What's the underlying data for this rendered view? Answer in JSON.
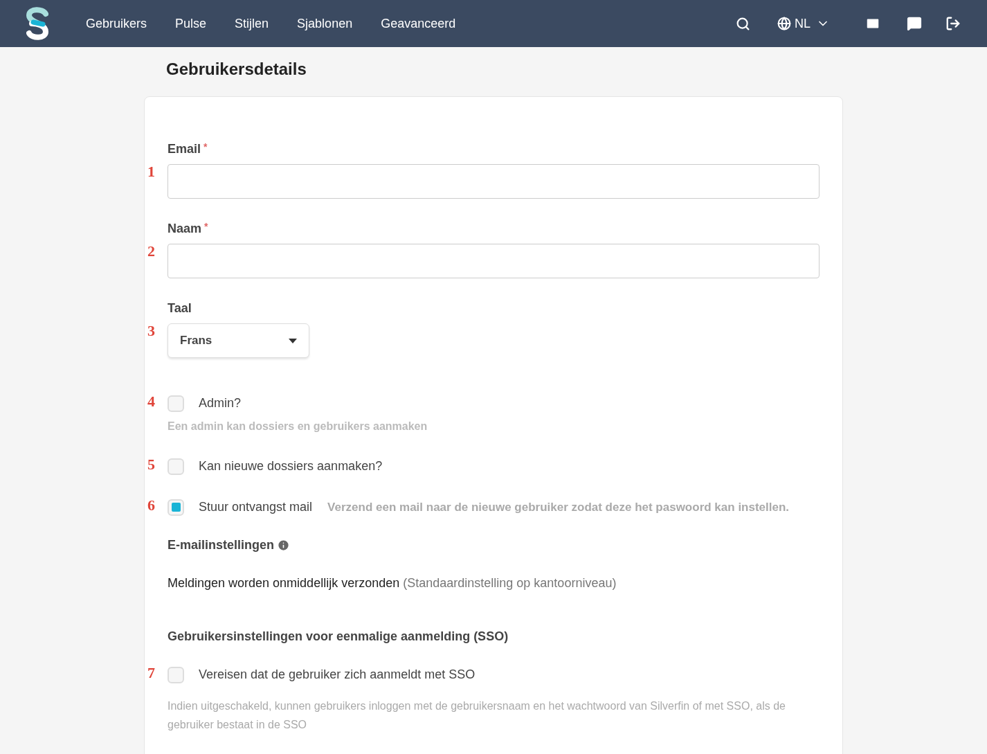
{
  "nav": {
    "items": [
      {
        "label": "Gebruikers"
      },
      {
        "label": "Pulse"
      },
      {
        "label": "Stijlen"
      },
      {
        "label": "Sjablonen"
      },
      {
        "label": "Geavanceerd"
      }
    ],
    "language": "NL"
  },
  "page_title": "Gebruikersdetails",
  "fields": [
    {
      "kind": "text",
      "marker": "1",
      "label": "Email",
      "required": true,
      "required_mark": "*"
    },
    {
      "kind": "text",
      "marker": "2",
      "label": "Naam",
      "required": true,
      "required_mark": "*"
    },
    {
      "kind": "select",
      "marker": "3",
      "label": "Taal",
      "value": "Frans"
    },
    {
      "kind": "checkbox",
      "marker": "4",
      "label": "Admin?",
      "checked": false,
      "help": "Een admin kan dossiers en gebruikers aanmaken"
    },
    {
      "kind": "checkbox",
      "marker": "5",
      "label": "Kan nieuwe dossiers aanmaken?",
      "checked": false
    },
    {
      "kind": "checkbox",
      "marker": "6",
      "label": "Stuur ontvangst mail",
      "checked": true,
      "inline_help": "Verzend een mail naar de nieuwe gebruiker zodat deze het paswoord kan instellen."
    },
    {
      "kind": "heading",
      "label": "E-mailinstellingen",
      "info": true
    },
    {
      "kind": "notice",
      "text": "Meldingen worden onmiddellijk verzonden",
      "note": "(Standaardinstelling op kantoorniveau)"
    },
    {
      "kind": "heading",
      "label": "Gebruikersinstellingen voor eenmalige aanmelding (SSO)",
      "info": false
    },
    {
      "kind": "checkbox",
      "marker": "7",
      "label": "Vereisen dat de gebruiker zich aanmeldt met SSO",
      "checked": false,
      "help_block": "Indien uitgeschakeld, kunnen gebruikers inloggen met de gebruikersnaam en het wachtwoord van Silverfin of met SSO, als de gebruiker bestaat in de SSO"
    }
  ]
}
